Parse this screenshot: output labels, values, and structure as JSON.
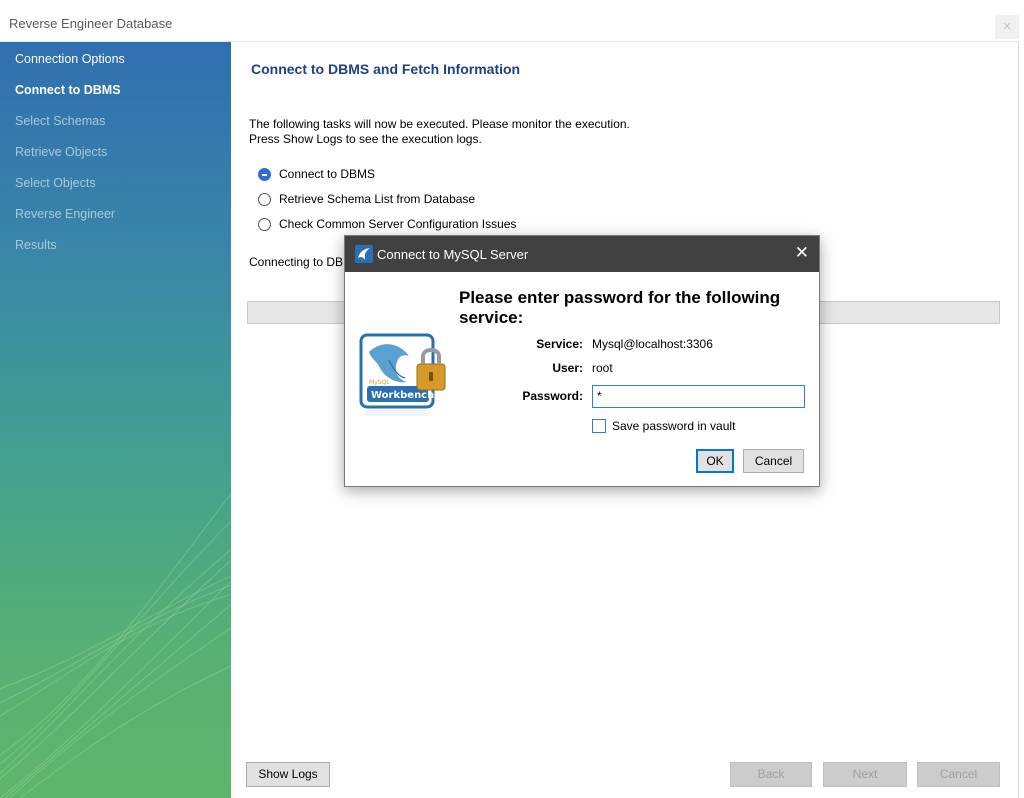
{
  "window": {
    "title": "Reverse Engineer Database"
  },
  "sidebar": {
    "steps": [
      {
        "label": "Connection Options",
        "state": "done"
      },
      {
        "label": "Connect to DBMS",
        "state": "current"
      },
      {
        "label": "Select Schemas",
        "state": "pending"
      },
      {
        "label": "Retrieve Objects",
        "state": "pending"
      },
      {
        "label": "Select Objects",
        "state": "pending"
      },
      {
        "label": "Reverse Engineer",
        "state": "pending"
      },
      {
        "label": "Results",
        "state": "pending"
      }
    ]
  },
  "main": {
    "heading": "Connect to DBMS and Fetch Information",
    "description_line1": "The following tasks will now be executed. Please monitor the execution.",
    "description_line2": "Press Show Logs to see the execution logs.",
    "tasks": [
      {
        "label": "Connect to DBMS",
        "state": "running"
      },
      {
        "label": "Retrieve Schema List from Database",
        "state": "pending"
      },
      {
        "label": "Check Common Server Configuration Issues",
        "state": "pending"
      }
    ],
    "status": "Connecting to DB"
  },
  "footer": {
    "show_logs": "Show Logs",
    "back": "Back",
    "next": "Next",
    "cancel": "Cancel"
  },
  "dialog": {
    "title": "Connect to MySQL Server",
    "close_glyph": "✕",
    "heading": "Please enter password for the following service:",
    "service_label": "Service:",
    "service_value": "Mysql@localhost:3306",
    "user_label": "User:",
    "user_value": "root",
    "password_label": "Password:",
    "password_value": "*",
    "save_password_label": "Save password in vault",
    "save_password_checked": false,
    "ok": "OK",
    "cancel": "Cancel",
    "logo_text_top": "MySQL",
    "logo_text": "Workbench"
  },
  "colors": {
    "heading_blue": "#1e3f8a",
    "dialog_titlebar": "#414141",
    "focus_blue": "#2a7de1"
  }
}
